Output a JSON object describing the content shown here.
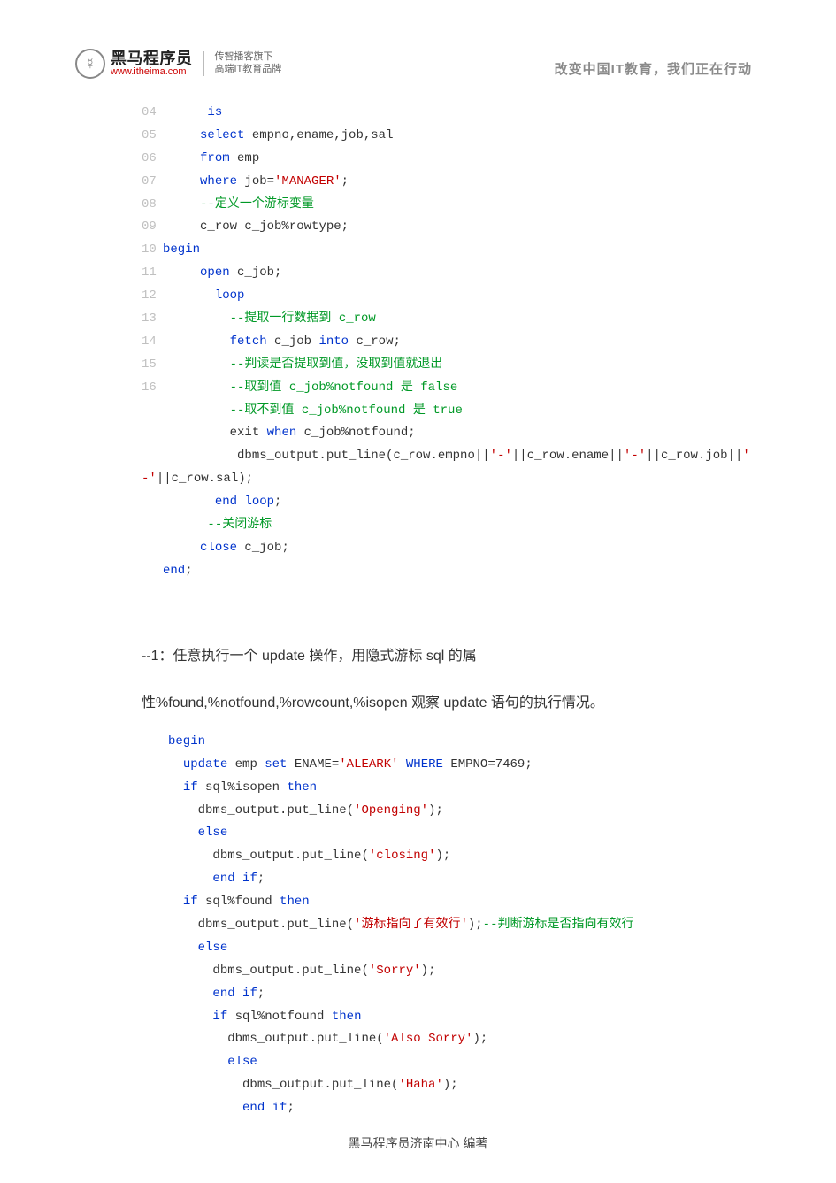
{
  "header": {
    "logo_glyph": "☿",
    "logo_cn": "黑马程序员",
    "logo_url": "www.itheima.com",
    "logo_sub_1": "传智播客旗下",
    "logo_sub_2": "高端IT教育品牌",
    "slogan": "改变中国IT教育，我们正在行动"
  },
  "code1": {
    "lines": [
      {
        "ln": "04",
        "indent": "      ",
        "parts": [
          {
            "cls": "kw",
            "t": "is"
          }
        ]
      },
      {
        "ln": "05",
        "indent": "     ",
        "parts": [
          {
            "cls": "kw",
            "t": "select"
          },
          {
            "cls": "pl",
            "t": " empno,ename,job,sal"
          }
        ]
      },
      {
        "ln": "06",
        "indent": "     ",
        "parts": [
          {
            "cls": "kw",
            "t": "from"
          },
          {
            "cls": "pl",
            "t": " emp"
          }
        ]
      },
      {
        "ln": "07",
        "indent": "     ",
        "parts": [
          {
            "cls": "kw",
            "t": "where"
          },
          {
            "cls": "pl",
            "t": " job="
          },
          {
            "cls": "str",
            "t": "'MANAGER'"
          },
          {
            "cls": "pl",
            "t": ";"
          }
        ]
      },
      {
        "ln": "08",
        "indent": "     ",
        "parts": [
          {
            "cls": "cm",
            "t": "--定义一个游标变量"
          }
        ]
      },
      {
        "ln": "09",
        "indent": "     ",
        "parts": [
          {
            "cls": "pl",
            "t": "c_row c_job%rowtype;"
          }
        ]
      },
      {
        "ln": "10",
        "indent": "",
        "parts": [
          {
            "cls": "kw",
            "t": "begin"
          }
        ]
      },
      {
        "ln": "11",
        "indent": "     ",
        "parts": [
          {
            "cls": "kw",
            "t": "open"
          },
          {
            "cls": "pl",
            "t": " c_job;"
          }
        ]
      },
      {
        "ln": "12",
        "indent": "       ",
        "parts": [
          {
            "cls": "kw",
            "t": "loop"
          }
        ]
      },
      {
        "ln": "13",
        "indent": "         ",
        "parts": [
          {
            "cls": "cm",
            "t": "--提取一行数据到 c_row"
          }
        ]
      },
      {
        "ln": "14",
        "indent": "         ",
        "parts": [
          {
            "cls": "kw",
            "t": "fetch"
          },
          {
            "cls": "pl",
            "t": " c_job "
          },
          {
            "cls": "kw",
            "t": "into"
          },
          {
            "cls": "pl",
            "t": " c_row;"
          }
        ]
      },
      {
        "ln": "15",
        "indent": "         ",
        "parts": [
          {
            "cls": "cm",
            "t": "--判读是否提取到值，没取到值就退出"
          }
        ]
      },
      {
        "ln": "16",
        "indent": "         ",
        "parts": [
          {
            "cls": "cm",
            "t": "--取到值 c_job%notfound 是 false"
          }
        ]
      },
      {
        "ln": "",
        "indent": "         ",
        "parts": [
          {
            "cls": "cm",
            "t": "--取不到值 c_job%notfound 是 true"
          }
        ]
      },
      {
        "ln": "",
        "indent": "         ",
        "parts": [
          {
            "cls": "pl",
            "t": "exit "
          },
          {
            "cls": "kw",
            "t": "when"
          },
          {
            "cls": "pl",
            "t": " c_job%notfound;"
          }
        ]
      },
      {
        "ln": "",
        "indent": "          ",
        "parts": [
          {
            "cls": "pl",
            "t": "dbms_output.put_line(c_row.empno||"
          },
          {
            "cls": "str",
            "t": "'-'"
          },
          {
            "cls": "pl",
            "t": "||c_row.ename||"
          },
          {
            "cls": "str",
            "t": "'-'"
          },
          {
            "cls": "pl",
            "t": "||c_row.job||"
          },
          {
            "cls": "str",
            "t": "'"
          }
        ]
      }
    ],
    "wrap_line_parts": [
      {
        "cls": "str",
        "t": "-'"
      },
      {
        "cls": "pl",
        "t": "||c_row.sal);"
      }
    ],
    "tail": [
      {
        "indent": "       ",
        "parts": [
          {
            "cls": "kw",
            "t": "end"
          },
          {
            "cls": "pl",
            "t": " "
          },
          {
            "cls": "kw",
            "t": "loop"
          },
          {
            "cls": "pl",
            "t": ";"
          }
        ]
      },
      {
        "indent": "      ",
        "parts": [
          {
            "cls": "cm",
            "t": "--关闭游标"
          }
        ]
      },
      {
        "indent": "     ",
        "parts": [
          {
            "cls": "kw",
            "t": "close"
          },
          {
            "cls": "pl",
            "t": " c_job;"
          }
        ]
      },
      {
        "indent": "",
        "parts": [
          {
            "cls": "kw",
            "t": "end"
          },
          {
            "cls": "pl",
            "t": ";"
          }
        ]
      }
    ]
  },
  "para1": "--1：任意执行一个 update 操作，用隐式游标 sql 的属",
  "para2": "性%found,%notfound,%rowcount,%isopen 观察 update 语句的执行情况。",
  "code2": {
    "lines": [
      {
        "indent": "",
        "parts": [
          {
            "cls": "kw",
            "t": "begin"
          }
        ]
      },
      {
        "indent": "  ",
        "parts": [
          {
            "cls": "kw",
            "t": "update"
          },
          {
            "cls": "pl",
            "t": " emp "
          },
          {
            "cls": "kw",
            "t": "set"
          },
          {
            "cls": "pl",
            "t": " ENAME="
          },
          {
            "cls": "str",
            "t": "'ALEARK'"
          },
          {
            "cls": "pl",
            "t": " "
          },
          {
            "cls": "kw",
            "t": "WHERE"
          },
          {
            "cls": "pl",
            "t": " EMPNO=7469;"
          }
        ]
      },
      {
        "indent": "  ",
        "parts": [
          {
            "cls": "kw",
            "t": "if"
          },
          {
            "cls": "pl",
            "t": " sql%isopen "
          },
          {
            "cls": "kw",
            "t": "then"
          }
        ]
      },
      {
        "indent": "    ",
        "parts": [
          {
            "cls": "pl",
            "t": "dbms_output.put_line("
          },
          {
            "cls": "str",
            "t": "'Openging'"
          },
          {
            "cls": "pl",
            "t": ");"
          }
        ]
      },
      {
        "indent": "    ",
        "parts": [
          {
            "cls": "kw",
            "t": "else"
          }
        ]
      },
      {
        "indent": "      ",
        "parts": [
          {
            "cls": "pl",
            "t": "dbms_output.put_line("
          },
          {
            "cls": "str",
            "t": "'closing'"
          },
          {
            "cls": "pl",
            "t": ");"
          }
        ]
      },
      {
        "indent": "      ",
        "parts": [
          {
            "cls": "kw",
            "t": "end"
          },
          {
            "cls": "pl",
            "t": " "
          },
          {
            "cls": "kw",
            "t": "if"
          },
          {
            "cls": "pl",
            "t": ";"
          }
        ]
      },
      {
        "indent": "  ",
        "parts": [
          {
            "cls": "kw",
            "t": "if"
          },
          {
            "cls": "pl",
            "t": " sql%found "
          },
          {
            "cls": "kw",
            "t": "then"
          }
        ]
      },
      {
        "indent": "    ",
        "parts": [
          {
            "cls": "pl",
            "t": "dbms_output.put_line("
          },
          {
            "cls": "str",
            "t": "'游标指向了有效行'"
          },
          {
            "cls": "pl",
            "t": ");"
          },
          {
            "cls": "cm",
            "t": "--判断游标是否指向有效行"
          }
        ]
      },
      {
        "indent": "    ",
        "parts": [
          {
            "cls": "kw",
            "t": "else"
          }
        ]
      },
      {
        "indent": "      ",
        "parts": [
          {
            "cls": "pl",
            "t": "dbms_output.put_line("
          },
          {
            "cls": "str",
            "t": "'Sorry'"
          },
          {
            "cls": "pl",
            "t": ");"
          }
        ]
      },
      {
        "indent": "      ",
        "parts": [
          {
            "cls": "kw",
            "t": "end"
          },
          {
            "cls": "pl",
            "t": " "
          },
          {
            "cls": "kw",
            "t": "if"
          },
          {
            "cls": "pl",
            "t": ";"
          }
        ]
      },
      {
        "indent": "      ",
        "parts": [
          {
            "cls": "kw",
            "t": "if"
          },
          {
            "cls": "pl",
            "t": " sql%notfound "
          },
          {
            "cls": "kw",
            "t": "then"
          }
        ]
      },
      {
        "indent": "        ",
        "parts": [
          {
            "cls": "pl",
            "t": "dbms_output.put_line("
          },
          {
            "cls": "str",
            "t": "'Also Sorry'"
          },
          {
            "cls": "pl",
            "t": ");"
          }
        ]
      },
      {
        "indent": "        ",
        "parts": [
          {
            "cls": "kw",
            "t": "else"
          }
        ]
      },
      {
        "indent": "          ",
        "parts": [
          {
            "cls": "pl",
            "t": "dbms_output.put_line("
          },
          {
            "cls": "str",
            "t": "'Haha'"
          },
          {
            "cls": "pl",
            "t": ");"
          }
        ]
      },
      {
        "indent": "          ",
        "parts": [
          {
            "cls": "kw",
            "t": "end"
          },
          {
            "cls": "pl",
            "t": " "
          },
          {
            "cls": "kw",
            "t": "if"
          },
          {
            "cls": "pl",
            "t": ";"
          }
        ]
      }
    ]
  },
  "footer": "黑马程序员济南中心 编著"
}
